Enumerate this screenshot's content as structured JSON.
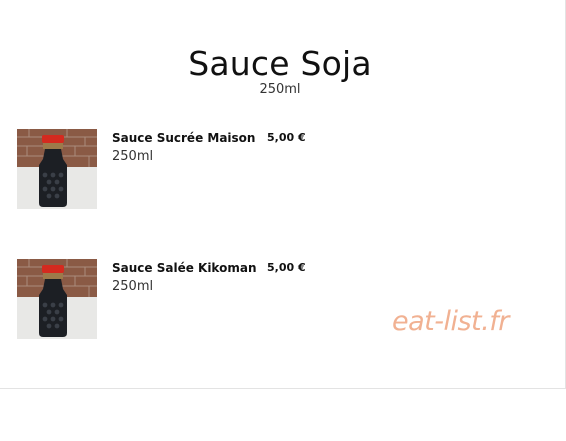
{
  "menu": {
    "title": "Sauce Soja",
    "subtitle": "250ml",
    "items": [
      {
        "name": "Sauce Sucrée Maison",
        "price": "5,00 €",
        "volume": "250ml",
        "image_icon": "soy-sauce-bottle"
      },
      {
        "name": "Sauce Salée Kikoman",
        "price": "5,00 €",
        "volume": "250ml",
        "image_icon": "soy-sauce-bottle"
      }
    ]
  },
  "watermark": "eat-list.fr",
  "colors": {
    "watermark": "#f1b192",
    "bottle_cap": "#d42a1f",
    "bottle_body": "#1c1f24",
    "brick_wall": "#8a5a45"
  }
}
